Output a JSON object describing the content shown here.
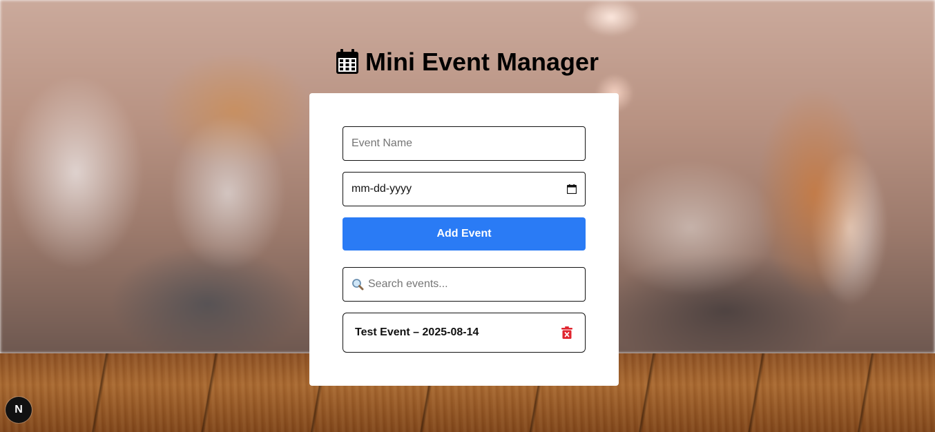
{
  "header": {
    "title": "Mini Event Manager",
    "icon": "calendar-icon"
  },
  "form": {
    "event_name_placeholder": "Event Name",
    "date_value": "mm-dd-yyyy",
    "add_button_label": "Add Event"
  },
  "search": {
    "placeholder": "Search events...",
    "icon": "magnifier-icon"
  },
  "events": [
    {
      "label": "Test Event – 2025-08-14",
      "delete_icon": "trash-icon"
    }
  ],
  "badge": {
    "label": "N"
  },
  "colors": {
    "accent": "#2a7bf5",
    "delete": "#e0252f",
    "card": "#ffffff"
  }
}
